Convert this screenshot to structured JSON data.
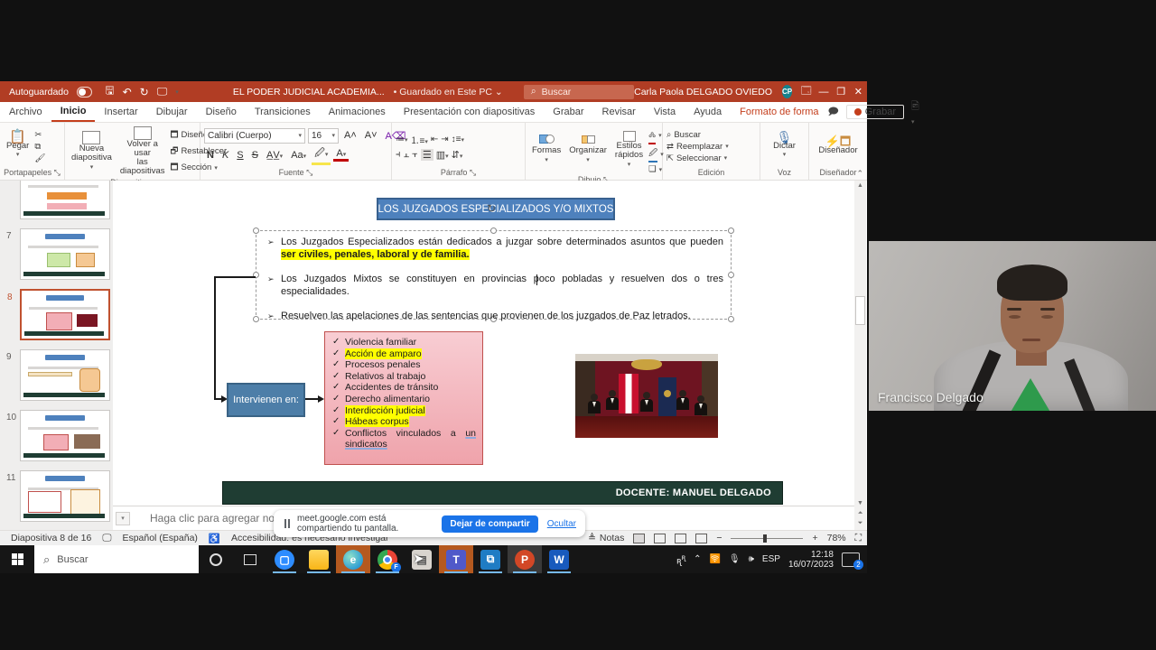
{
  "titlebar": {
    "autosave": "Autoguardado",
    "doc_title": "EL PODER JUDICIAL ACADEMIA...",
    "saved_state": "Guardado en Este PC",
    "search_placeholder": "Buscar",
    "user_name": "Carla Paola DELGADO OVIEDO",
    "user_initials": "CP"
  },
  "ribbon_tabs": [
    {
      "label": "Archivo"
    },
    {
      "label": "Inicio",
      "active": true
    },
    {
      "label": "Insertar"
    },
    {
      "label": "Dibujar"
    },
    {
      "label": "Diseño"
    },
    {
      "label": "Transiciones"
    },
    {
      "label": "Animaciones"
    },
    {
      "label": "Presentación con diapositivas"
    },
    {
      "label": "Grabar"
    },
    {
      "label": "Revisar"
    },
    {
      "label": "Vista"
    },
    {
      "label": "Ayuda"
    },
    {
      "label": "Formato de forma",
      "contextual": true
    }
  ],
  "ribbon_actions": {
    "record": "Grabar"
  },
  "ribbon": {
    "paste": "Pegar",
    "group_clipboard": "Portapapeles",
    "new_slide_1": "Nueva",
    "new_slide_2": "diapositiva",
    "reuse_1": "Volver a usar",
    "reuse_2": "las diapositivas",
    "design": "Diseño",
    "reset": "Restablecer",
    "section": "Sección",
    "group_slides": "Diapositivas",
    "font_name": "Calibri (Cuerpo)",
    "font_size": "16",
    "bold": "N",
    "italic": "K",
    "underline": "S",
    "strikethrough": "S",
    "aa": "Aa",
    "group_font": "Fuente",
    "group_paragraph": "Párrafo",
    "shapes": "Formas",
    "arrange": "Organizar",
    "styles_1": "Estilos",
    "styles_2": "rápidos",
    "group_drawing": "Dibujo",
    "find": "Buscar",
    "replace": "Reemplazar",
    "select": "Seleccionar",
    "group_editing": "Edición",
    "dictate": "Dictar",
    "group_voice": "Voz",
    "designer": "Diseñador",
    "group_designer": "Diseñador"
  },
  "thumbnails": [
    {
      "num": "",
      "variant": "v6"
    },
    {
      "num": "7",
      "variant": "v7"
    },
    {
      "num": "8",
      "variant": "v8",
      "selected": true
    },
    {
      "num": "9",
      "variant": "v9"
    },
    {
      "num": "10",
      "variant": "v10"
    },
    {
      "num": "11",
      "variant": "v11"
    }
  ],
  "slide": {
    "title": "LOS JUZGADOS ESPECIALIZADOS Y/O MIXTOS",
    "bullets": [
      {
        "pre": "Los Juzgados Especializados están dedicados a juzgar sobre determinados asuntos que pueden ",
        "highlight": "ser civiles, penales, laboral y de familia."
      },
      {
        "pre": "Los Juzgados Mixtos se constituyen en provincias poco pobladas y resuelven dos o tres especialidades.",
        "highlight": ""
      },
      {
        "pre": "Resuelven las apelaciones de las sentencias que provienen de los juzgados de Paz letrados.",
        "highlight": ""
      }
    ],
    "connector_label": "Intervienen en:",
    "checklist": [
      {
        "text": "Violencia familiar"
      },
      {
        "text": "Acción de amparo",
        "hl": true
      },
      {
        "text": "Procesos penales"
      },
      {
        "text": "Relativos al trabajo"
      },
      {
        "text": "Accidentes de tránsito"
      },
      {
        "text": "Derecho alimentario"
      },
      {
        "text": "Interdicción judicial",
        "hl": true
      },
      {
        "text": "Hábeas corpus",
        "hl": true
      },
      {
        "text": "Conflictos vinculados a ",
        "underline": "un sindicatos",
        "justify": true
      }
    ],
    "footer": "DOCENTE: MANUEL DELGADO"
  },
  "notes_placeholder": "Haga clic para agregar notas",
  "statusbar": {
    "slide_info": "Diapositiva 8 de 16",
    "language": "Español (España)",
    "accessibility": "Accesibilidad: es necesario investigar",
    "notes": "Notas",
    "zoom_level": "78%"
  },
  "meet_bar": {
    "message": "meet.google.com está compartiendo tu pantalla.",
    "stop_button": "Dejar de compartir",
    "hide_link": "Ocultar"
  },
  "taskbar": {
    "search_placeholder": "Buscar",
    "language": "ESP",
    "time": "12:18",
    "date": "16/07/2023",
    "notification_count": "2"
  },
  "webcam": {
    "name": "Francisco Delgado"
  },
  "colors": {
    "titlebar_red": "#B13D24",
    "accent_blue_box": "#4E81BD",
    "highlight_yellow": "#FFFF00",
    "pink_box": "#F2AEB6",
    "banner_green": "#1F3D33",
    "meet_blue": "#1A73E8",
    "selected_thumb_border": "#C0512F"
  }
}
